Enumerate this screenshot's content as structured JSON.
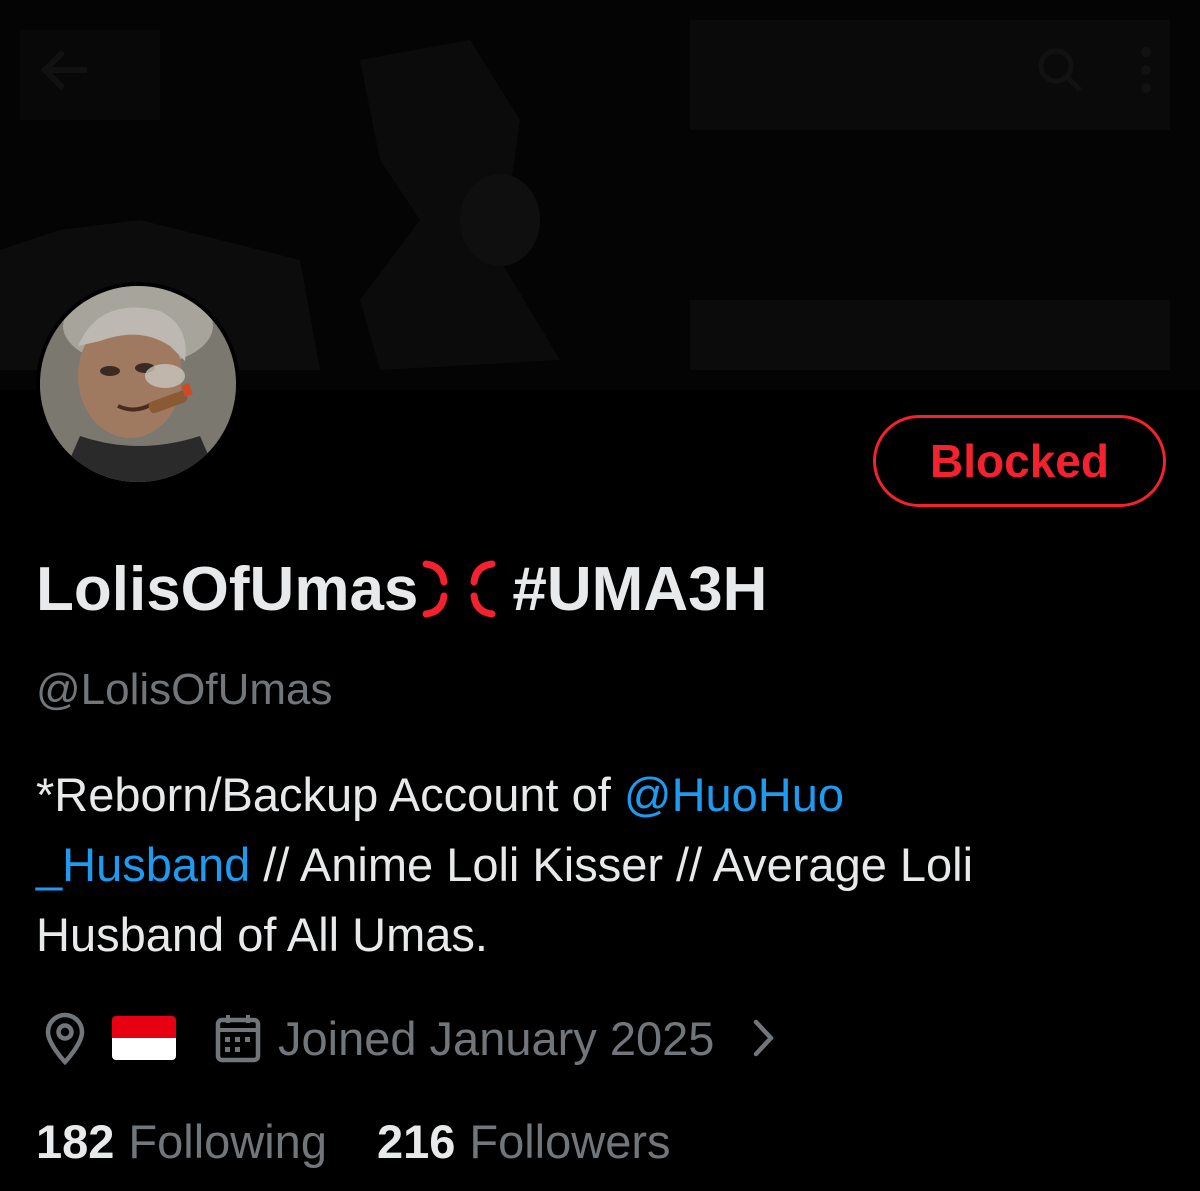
{
  "profile": {
    "display_name": "LolisOfUmas",
    "display_name_suffix": "#UMA3H",
    "name_emoji": "anger-emoji",
    "handle": "@LolisOfUmas",
    "bio": {
      "text_1": "*Reborn/Backup Account of ",
      "mention_part_1": "@HuoHuo",
      "mention_part_2": "_Husband",
      "text_2": " // Anime Loli Kisser // Average Loli",
      "text_3": "Husband of All Umas."
    },
    "location_icon": "location-pin-icon",
    "location_flag": "indonesia-flag",
    "joined": "Joined January 2025",
    "following_count": "182",
    "following_label": "Following",
    "followers_count": "216",
    "followers_label": "Followers"
  },
  "actions": {
    "blocked_label": "Blocked"
  },
  "colors": {
    "background": "#000000",
    "text_primary": "#e7e9ea",
    "text_secondary": "#71767b",
    "link": "#1d9bf0",
    "blocked": "#f4212e"
  },
  "topbar_icons": [
    "back-arrow-icon",
    "search-icon",
    "more-icon"
  ]
}
